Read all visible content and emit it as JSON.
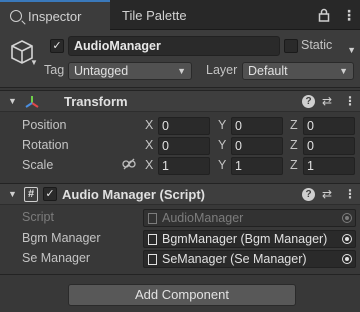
{
  "tabs": [
    {
      "label": "Inspector",
      "icon": "search-icon"
    },
    {
      "label": "Tile Palette"
    }
  ],
  "gameobject": {
    "active": true,
    "name": "AudioManager",
    "static_label": "Static",
    "static": false,
    "tag_label": "Tag",
    "tag_value": "Untagged",
    "layer_label": "Layer",
    "layer_value": "Default"
  },
  "transform": {
    "title": "Transform",
    "rows": [
      {
        "label": "Position",
        "x": "0",
        "y": "0",
        "z": "0"
      },
      {
        "label": "Rotation",
        "x": "0",
        "y": "0",
        "z": "0"
      },
      {
        "label": "Scale",
        "x": "1",
        "y": "1",
        "z": "1"
      }
    ],
    "axes": {
      "x": "X",
      "y": "Y",
      "z": "Z"
    }
  },
  "audio_manager": {
    "title": "Audio Manager (Script)",
    "enabled": true,
    "fields": [
      {
        "label": "Script",
        "value": "AudioManager",
        "disabled": true
      },
      {
        "label": "Bgm Manager",
        "value": "BgmManager (Bgm Manager)",
        "disabled": false
      },
      {
        "label": "Se Manager",
        "value": "SeManager (Se Manager)",
        "disabled": false
      }
    ]
  },
  "add_component_label": "Add Component",
  "colors": {
    "tab_accent": "#3a79bb",
    "background": "#383838"
  }
}
